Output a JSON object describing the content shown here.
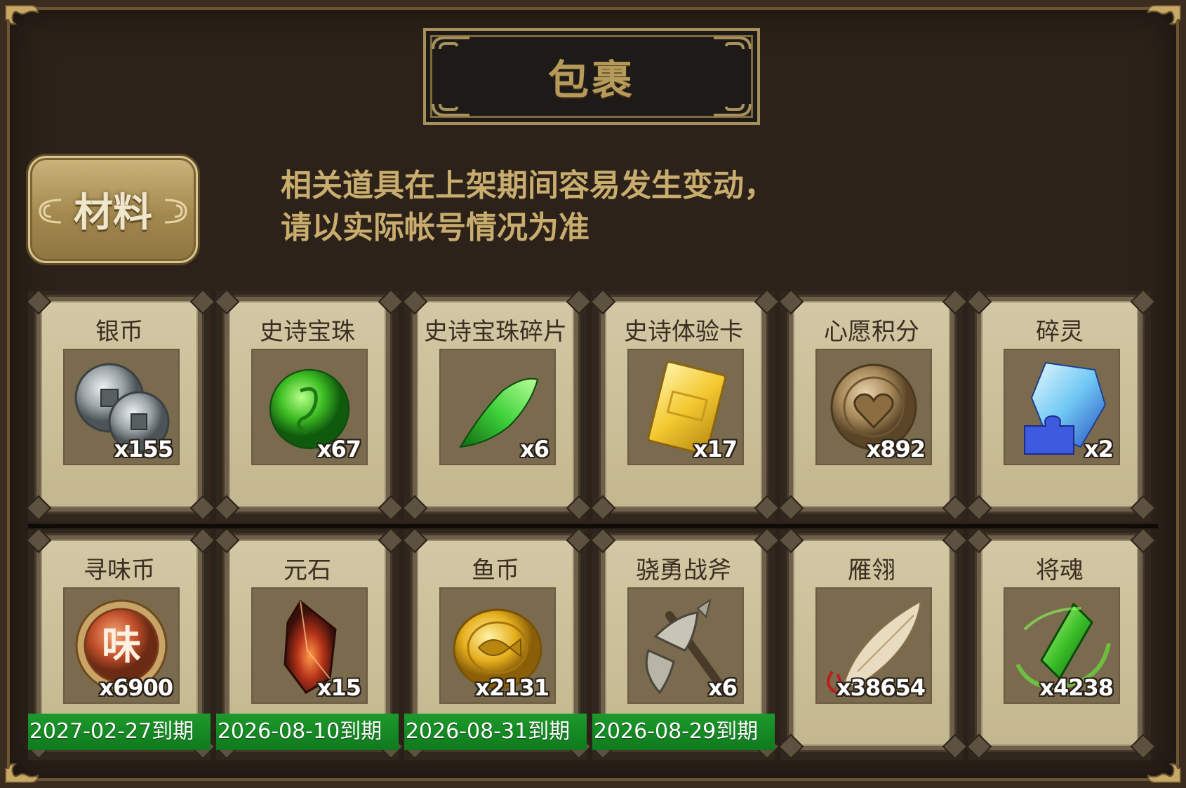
{
  "header": {
    "title": "包裹"
  },
  "tabs": [
    {
      "label": "材料",
      "active": true
    }
  ],
  "notice": {
    "line1": "相关道具在上架期间容易发生变动，",
    "line2": "请以实际帐号情况为准"
  },
  "colors": {
    "background": "#2c2219",
    "title_text": "#b59a5a",
    "notice_text": "#c9ad6e",
    "card_face": "#d3c8a4",
    "expiry_bar": "#1d9a2c"
  },
  "items": [
    {
      "name": "银币",
      "count": "x155",
      "icon": "silver-coin-icon",
      "expiry": ""
    },
    {
      "name": "史诗宝珠",
      "count": "x67",
      "icon": "green-orb-icon",
      "expiry": ""
    },
    {
      "name": "史诗宝珠碎片",
      "count": "x6",
      "icon": "jade-shard-icon",
      "expiry": ""
    },
    {
      "name": "史诗体验卡",
      "count": "x17",
      "icon": "gold-card-icon",
      "expiry": ""
    },
    {
      "name": "心愿积分",
      "count": "x892",
      "icon": "heart-coin-icon",
      "expiry": ""
    },
    {
      "name": "碎灵",
      "count": "x2",
      "icon": "crystal-puzzle-icon",
      "expiry": ""
    },
    {
      "name": "寻味币",
      "count": "x6900",
      "icon": "flavor-coin-icon",
      "expiry": "2027-02-27到期"
    },
    {
      "name": "元石",
      "count": "x15",
      "icon": "red-crystal-icon",
      "expiry": "2026-08-10到期"
    },
    {
      "name": "鱼币",
      "count": "x2131",
      "icon": "fish-coin-icon",
      "expiry": "2026-08-31到期"
    },
    {
      "name": "骁勇战斧",
      "count": "x6",
      "icon": "battle-axe-icon",
      "expiry": "2026-08-29到期"
    },
    {
      "name": "雁翎",
      "count": "x38654",
      "icon": "feather-icon",
      "expiry": ""
    },
    {
      "name": "将魂",
      "count": "x4238",
      "icon": "green-spirit-crystal-icon",
      "expiry": ""
    }
  ]
}
